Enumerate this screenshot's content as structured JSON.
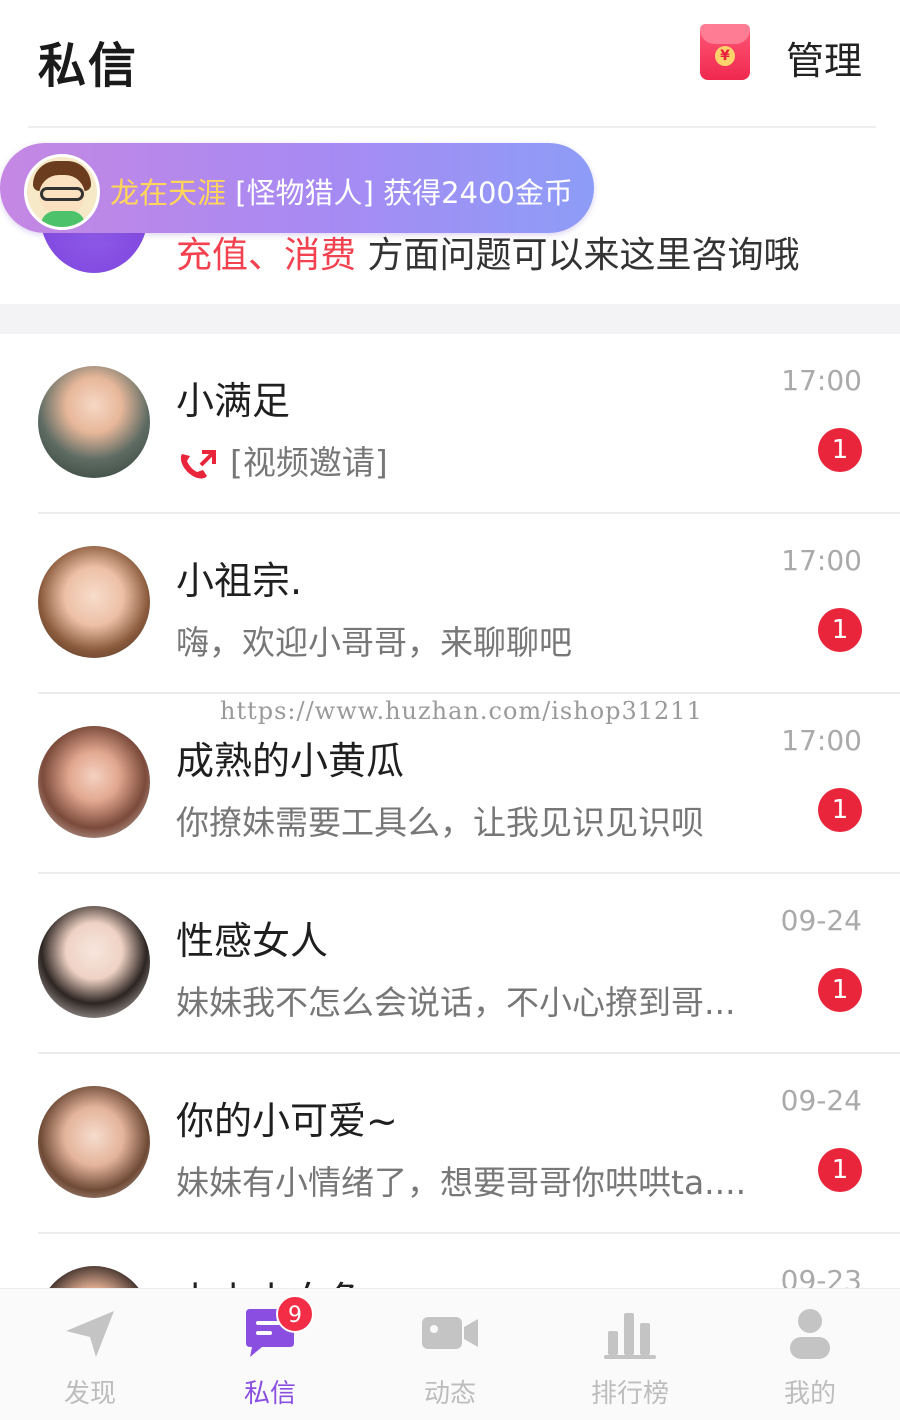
{
  "header": {
    "title": "私信",
    "manage_label": "管理",
    "redpacket_symbol": "¥"
  },
  "service": {
    "highlight": "充值、消费",
    "text": " 方面问题可以来这里咨询哦"
  },
  "gift_banner": {
    "user": "龙在天涯",
    "message": " [怪物猎人] 获得2400金币"
  },
  "watermark": "https://www.huzhan.com/ishop31211",
  "conversations": [
    {
      "name": "小满足",
      "preview": "[视频邀请]",
      "time": "17:00",
      "unread": "1",
      "is_video_invite": true
    },
    {
      "name": "小祖宗.",
      "preview": "嗨，欢迎小哥哥，来聊聊吧",
      "time": "17:00",
      "unread": "1"
    },
    {
      "name": "成熟的小黄瓜",
      "preview": "你撩妹需要工具么，让我见识见识呗",
      "time": "17:00",
      "unread": "1"
    },
    {
      "name": "性感女人",
      "preview": "妹妹我不怎么会说话，不小心撩到哥...",
      "time": "09-24",
      "unread": "1"
    },
    {
      "name": "你的小可爱~",
      "preview": "妹妹有小情绪了，想要哥哥你哄哄ta....",
      "time": "09-24",
      "unread": "1"
    },
    {
      "name": "小小小白兔",
      "preview": "",
      "time": "09-23",
      "unread": ""
    }
  ],
  "tabbar": {
    "tabs": [
      {
        "label": "发现",
        "icon": "navigation-arrow-icon"
      },
      {
        "label": "私信",
        "icon": "chat-bubble-icon",
        "active": true
      },
      {
        "label": "动态",
        "icon": "video-camera-icon"
      },
      {
        "label": "排行榜",
        "icon": "bar-chart-icon"
      },
      {
        "label": "我的",
        "icon": "person-icon"
      }
    ],
    "message_badge": "9"
  },
  "colors": {
    "accent_purple": "#8a4fe0",
    "badge_red": "#e8253a",
    "highlight_red": "#f3424f",
    "banner_username": "#ffd65a"
  }
}
